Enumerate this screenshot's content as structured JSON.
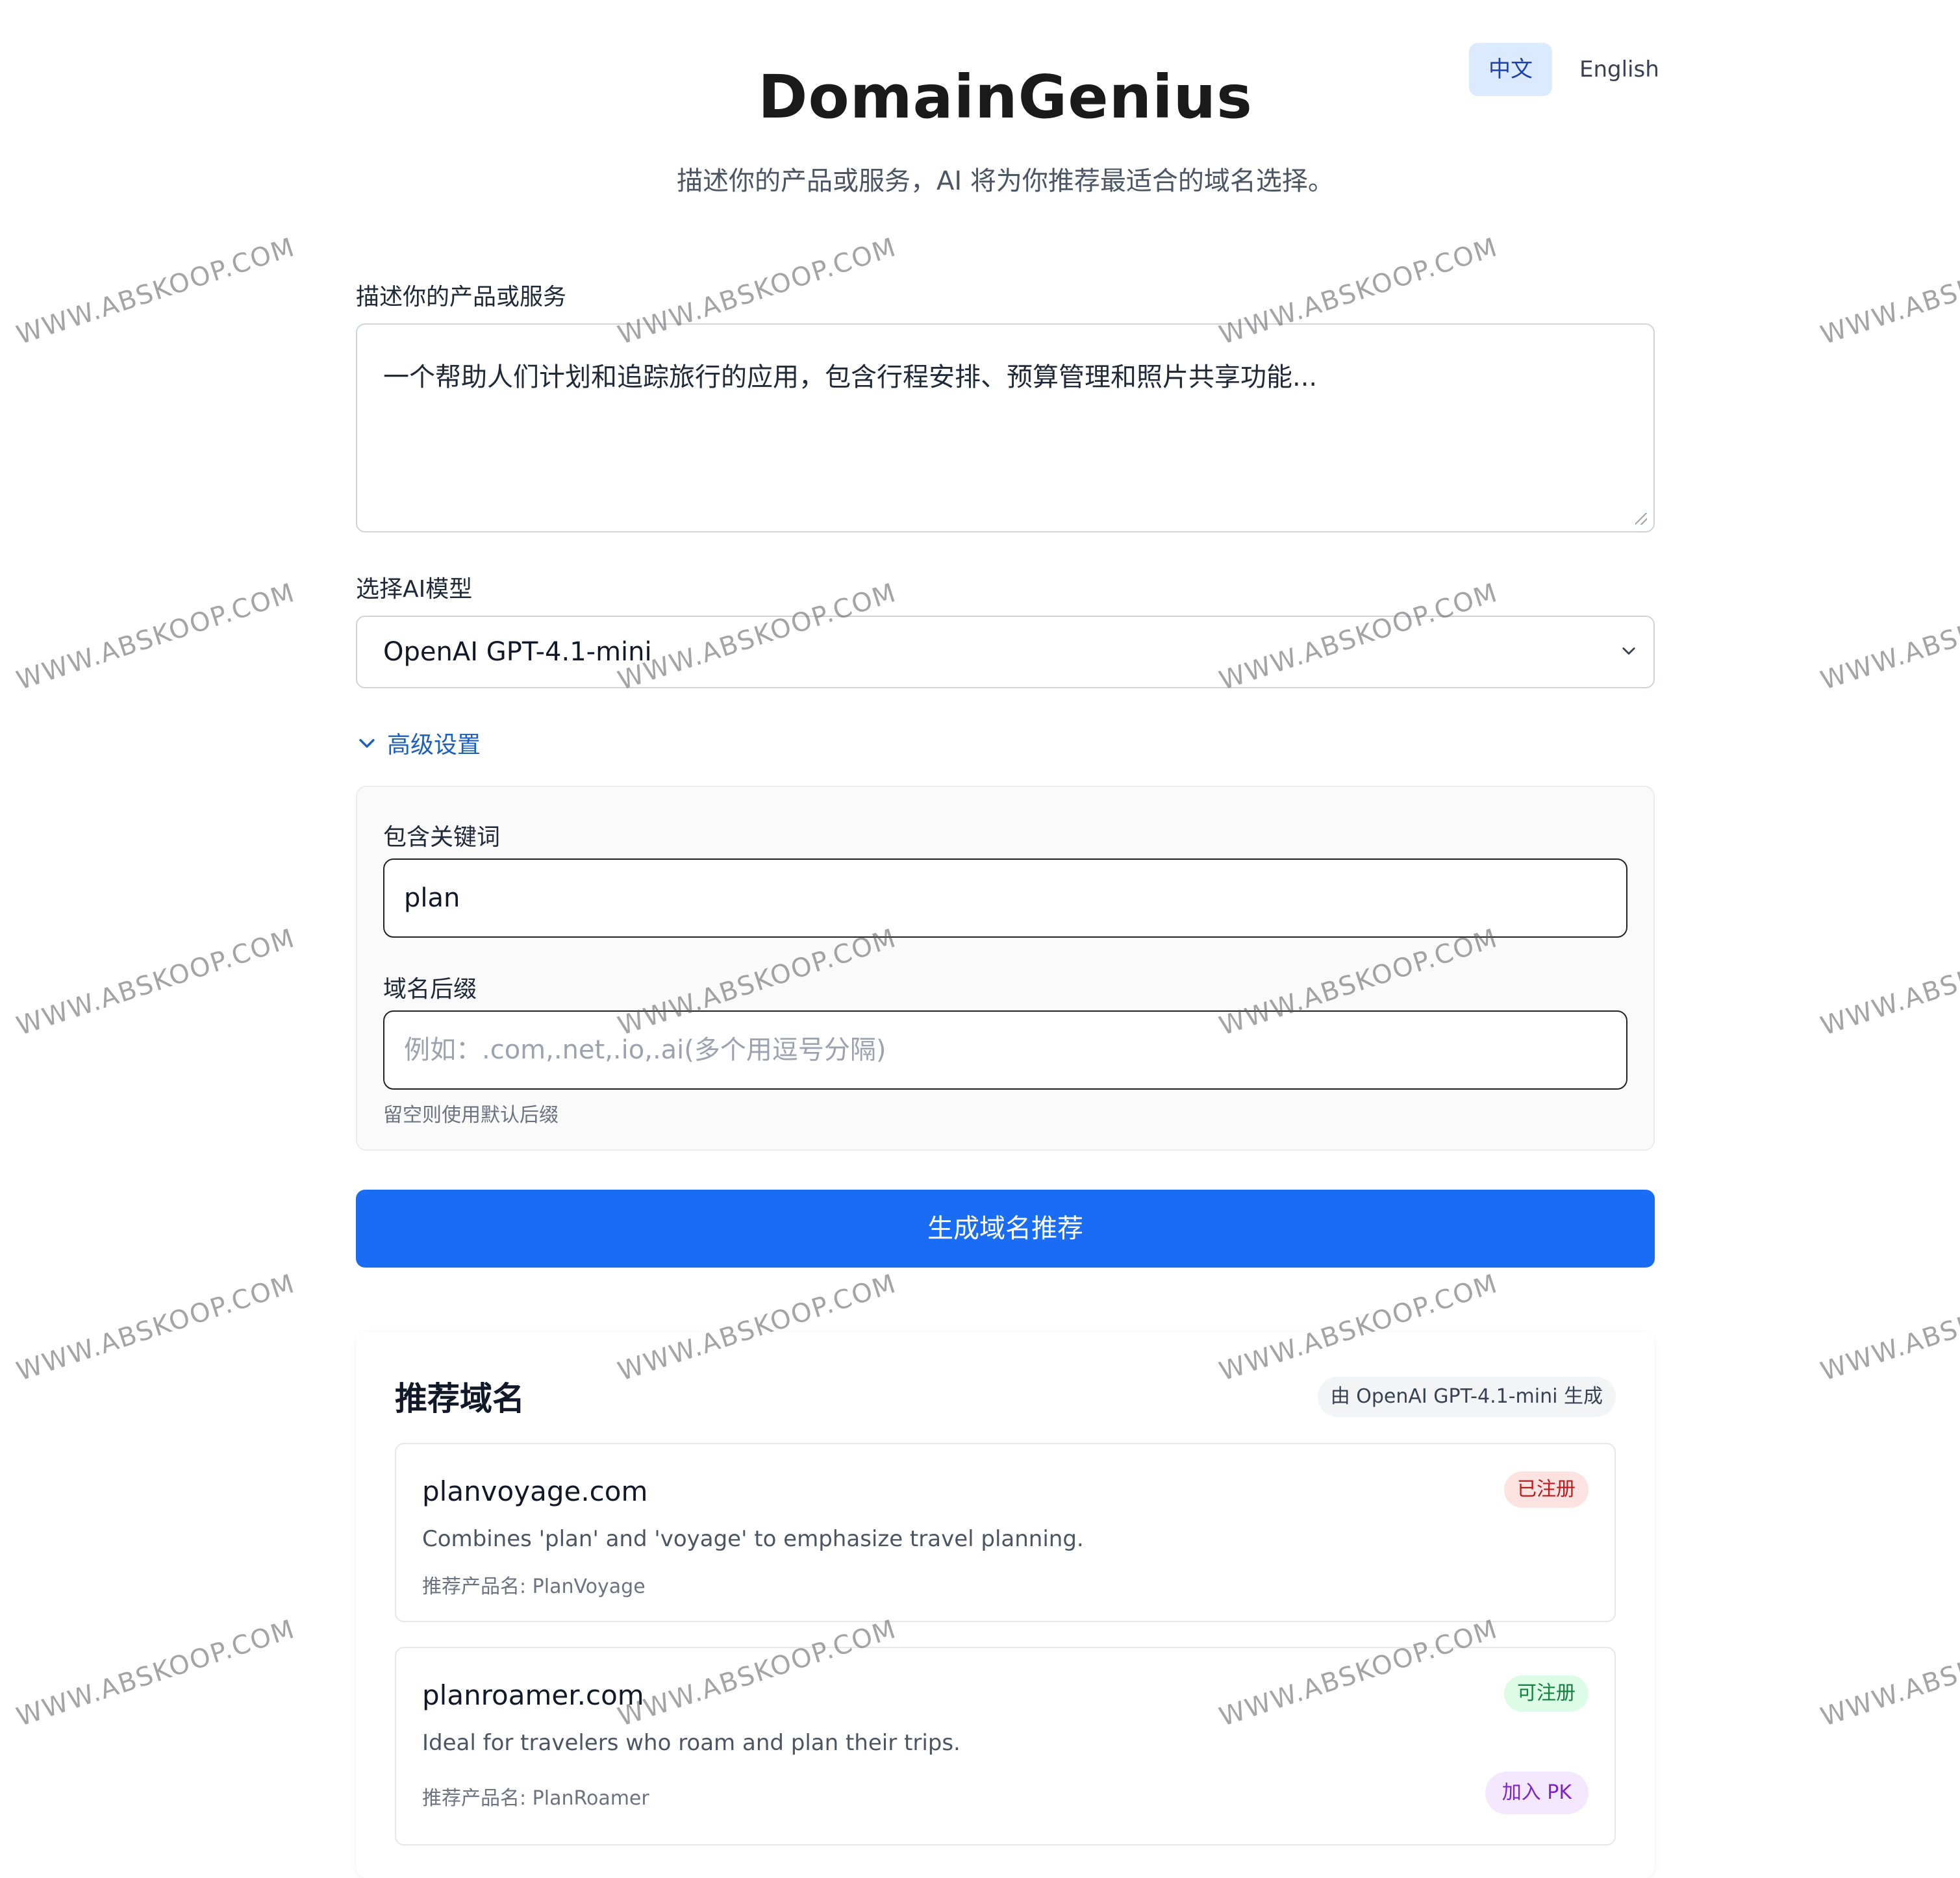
{
  "language": {
    "options": [
      "中文",
      "English"
    ],
    "active": "中文"
  },
  "header": {
    "title": "DomainGenius",
    "subtitle": "描述你的产品或服务，AI 将为你推荐最适合的域名选择。"
  },
  "form": {
    "description_label": "描述你的产品或服务",
    "description_value": "一个帮助人们计划和追踪旅行的应用，包含行程安排、预算管理和照片共享功能...",
    "model_label": "选择AI模型",
    "model_value": "OpenAI GPT-4.1-mini",
    "advanced_toggle": "高级设置",
    "keyword_label": "包含关键词",
    "keyword_value": "plan",
    "suffix_label": "域名后缀",
    "suffix_placeholder": "例如：.com,.net,.io,.ai(多个用逗号分隔)",
    "suffix_hint": "留空则使用默认后缀",
    "generate_button": "生成域名推荐"
  },
  "results": {
    "title": "推荐域名",
    "model_badge": "由 OpenAI GPT-4.1-mini 生成",
    "items": [
      {
        "domain": "planvoyage.com",
        "reason": "Combines 'plan' and 'voyage' to emphasize travel planning.",
        "product": "推荐产品名: PlanVoyage",
        "status": "已注册",
        "status_color": "#b91c1c"
      },
      {
        "domain": "planroamer.com",
        "reason": "Ideal for travelers who roam and plan their trips.",
        "product": "推荐产品名: PlanRoamer",
        "status": "可注册",
        "status_color": "#15803d",
        "action": "加入 PK"
      }
    ]
  },
  "watermark": "WWW.ABSKOOP.COM",
  "colors": {
    "primary": "#1a6cf5",
    "link": "#1d5fbf"
  }
}
